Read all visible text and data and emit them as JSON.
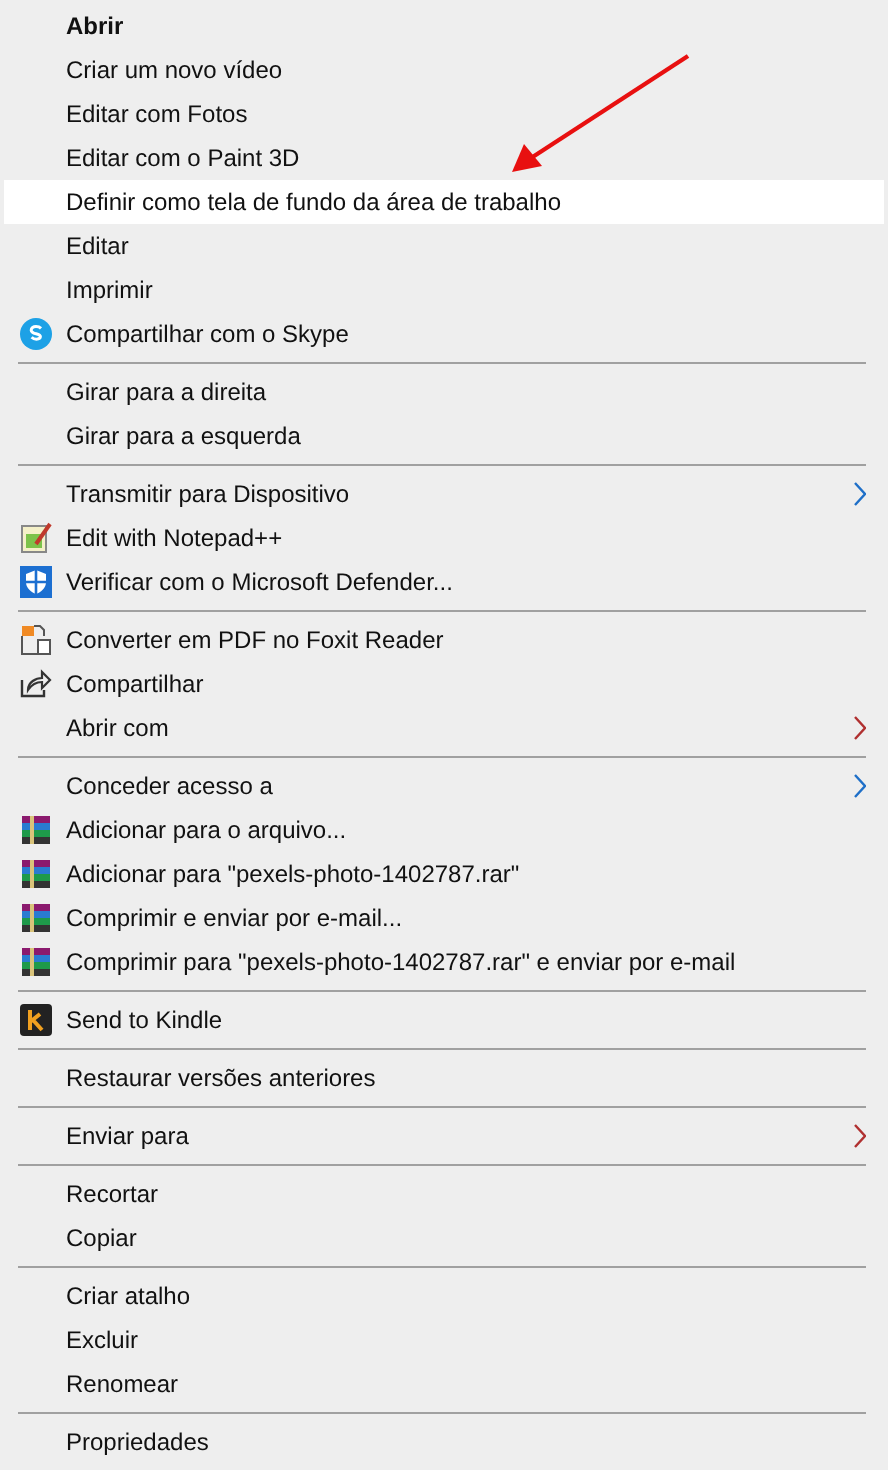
{
  "menu": {
    "sections": [
      {
        "items": [
          {
            "label": "Abrir",
            "bold": true,
            "selected": false
          },
          {
            "label": "Criar um novo vídeo",
            "bold": false,
            "selected": false
          },
          {
            "label": "Editar com Fotos",
            "bold": false,
            "selected": false
          },
          {
            "label": "Editar com o Paint 3D",
            "bold": false,
            "selected": false
          },
          {
            "label": "Definir como tela de fundo da área de trabalho",
            "bold": false,
            "selected": true
          },
          {
            "label": "Editar",
            "bold": false,
            "selected": false
          },
          {
            "label": "Imprimir",
            "bold": false,
            "selected": false
          },
          {
            "label": "Compartilhar com o Skype",
            "bold": false,
            "selected": false
          }
        ]
      },
      {
        "items": [
          {
            "label": "Girar para a direita",
            "bold": false,
            "selected": false
          },
          {
            "label": "Girar para a esquerda",
            "bold": false,
            "selected": false
          }
        ]
      },
      {
        "items": [
          {
            "label": "Transmitir para Dispositivo",
            "bold": false,
            "selected": false,
            "color": "#1e6fc8"
          },
          {
            "label": "Edit with Notepad++",
            "bold": false,
            "selected": false
          },
          {
            "label": "Verificar com o Microsoft Defender...",
            "bold": false,
            "selected": false
          }
        ]
      },
      {
        "items": [
          {
            "label": "Converter em PDF no Foxit Reader",
            "bold": false,
            "selected": false
          },
          {
            "label": "Compartilhar",
            "bold": false,
            "selected": false
          },
          {
            "label": "Abrir com",
            "bold": false,
            "selected": false,
            "color": "#b03030"
          }
        ]
      },
      {
        "items": [
          {
            "label": "Conceder acesso a",
            "bold": false,
            "selected": false,
            "color": "#1e6fc8"
          },
          {
            "label": "Adicionar para o arquivo...",
            "bold": false,
            "selected": false
          },
          {
            "label": "Adicionar para \"pexels-photo-1402787.rar\"",
            "bold": false,
            "selected": false
          },
          {
            "label": "Comprimir e enviar por e-mail...",
            "bold": false,
            "selected": false
          },
          {
            "label": "Comprimir para \"pexels-photo-1402787.rar\" e enviar por e-mail",
            "bold": false,
            "selected": false
          }
        ]
      },
      {
        "items": [
          {
            "label": "Send to Kindle",
            "bold": false,
            "selected": false
          }
        ]
      },
      {
        "items": [
          {
            "label": "Restaurar versões anteriores",
            "bold": false,
            "selected": false
          }
        ]
      },
      {
        "items": [
          {
            "label": "Enviar para",
            "bold": false,
            "selected": false,
            "color": "#b03030"
          }
        ]
      },
      {
        "items": [
          {
            "label": "Recortar",
            "bold": false,
            "selected": false
          },
          {
            "label": "Copiar",
            "bold": false,
            "selected": false
          }
        ]
      },
      {
        "items": [
          {
            "label": "Criar atalho",
            "bold": false,
            "selected": false
          },
          {
            "label": "Excluir",
            "bold": false,
            "selected": false
          },
          {
            "label": "Renomear",
            "bold": false,
            "selected": false
          }
        ]
      },
      {
        "items": [
          {
            "label": "Propriedades",
            "bold": false,
            "selected": false
          }
        ]
      }
    ]
  },
  "annotation": {
    "kind": "arrow"
  }
}
